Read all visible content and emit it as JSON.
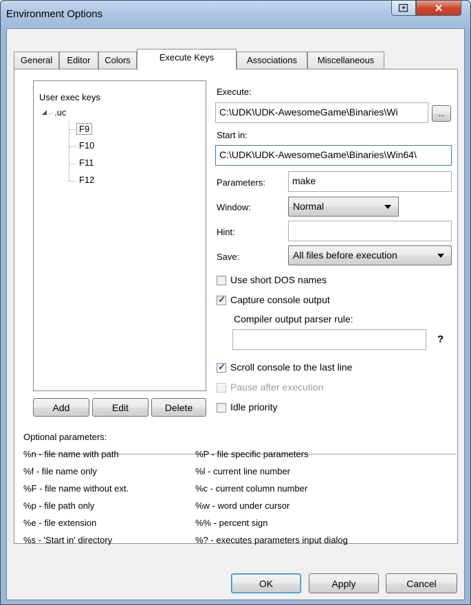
{
  "window": {
    "title": "Environment Options"
  },
  "tabs": [
    {
      "label": "General"
    },
    {
      "label": "Editor"
    },
    {
      "label": "Colors"
    },
    {
      "label": "Execute Keys"
    },
    {
      "label": "Associations"
    },
    {
      "label": "Miscellaneous"
    }
  ],
  "tree": {
    "root_label": "User exec keys",
    "group": ".uc",
    "keys": [
      "F9",
      "F10",
      "F11",
      "F12"
    ],
    "selected": "F9"
  },
  "tree_buttons": {
    "add": "Add",
    "edit": "Edit",
    "delete": "Delete"
  },
  "form": {
    "execute_label": "Execute:",
    "execute_value": "C:\\UDK\\UDK-AwesomeGame\\Binaries\\Wi",
    "browse_label": "...",
    "start_in_label": "Start in:",
    "start_in_value": "C:\\UDK\\UDK-AwesomeGame\\Binaries\\Win64\\",
    "parameters_label": "Parameters:",
    "parameters_value": "make",
    "window_label": "Window:",
    "window_value": "Normal",
    "hint_label": "Hint:",
    "hint_value": "",
    "save_label": "Save:",
    "save_value": "All files before execution",
    "use_short_dos": {
      "label": "Use short DOS names",
      "checked": false
    },
    "capture_console": {
      "label": "Capture console output",
      "checked": true
    },
    "compiler_rule_label": "Compiler output parser rule:",
    "compiler_rule_value": "",
    "help_glyph": "?",
    "scroll_console": {
      "label": "Scroll console to the last line",
      "checked": true
    },
    "pause_after": {
      "label": "Pause after execution",
      "checked": false,
      "disabled": true
    },
    "idle_priority": {
      "label": "Idle priority",
      "checked": false
    }
  },
  "help": {
    "title": "Optional parameters:",
    "left": [
      "%n  - file name with path",
      "%f   - file name only",
      "%F  - file name without ext.",
      "%p  - file path only",
      "%e  - file extension",
      "%s  - 'Start in' directory"
    ],
    "right": [
      "%P  - file specific parameters",
      "%l    - current line number",
      "%c  - current column number",
      "%w - word under cursor",
      "%%  - percent sign",
      "%?  - executes parameters input dialog"
    ]
  },
  "footer": {
    "ok": "OK",
    "apply": "Apply",
    "cancel": "Cancel"
  }
}
